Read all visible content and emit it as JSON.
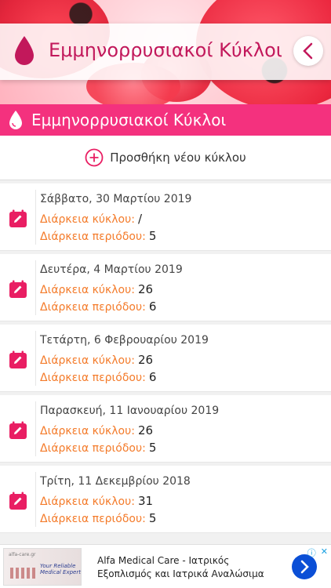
{
  "header": {
    "title": "Εμμηνορρυσιακοί Κύκλοι",
    "back_icon": "chevron-left-icon",
    "logo_icon": "blood-drop-icon"
  },
  "section": {
    "title": "Εμμηνορρυσιακοί Κύκλοι",
    "icon": "drop-icon"
  },
  "add_cycle": {
    "label": "Προσθήκη νέου κύκλου",
    "icon": "add-circle-icon"
  },
  "cycles": [
    {
      "date": "Σάββατο, 30 Μαρτίου 2019",
      "cycle_label": "Διάρκεια κύκλου:",
      "cycle_value": "/",
      "period_label": "Διάρκεια περιόδου:",
      "period_value": "5"
    },
    {
      "date": "Δευτέρα, 4 Μαρτίου 2019",
      "cycle_label": "Διάρκεια κύκλου:",
      "cycle_value": "26",
      "period_label": "Διάρκεια περιόδου:",
      "period_value": "6"
    },
    {
      "date": "Τετάρτη, 6 Φεβρουαρίου 2019",
      "cycle_label": "Διάρκεια κύκλου:",
      "cycle_value": "26",
      "period_label": "Διάρκεια περιόδου:",
      "period_value": "6"
    },
    {
      "date": "Παρασκευή, 11 Ιανουαρίου 2019",
      "cycle_label": "Διάρκεια κύκλου:",
      "cycle_value": "26",
      "period_label": "Διάρκεια περιόδου:",
      "period_value": "5"
    },
    {
      "date": "Τρίτη, 11 Δεκεμβρίου 2018",
      "cycle_label": "Διάρκεια κύκλου:",
      "cycle_value": "31",
      "period_label": "Διάρκεια περιόδου:",
      "period_value": "5"
    }
  ],
  "ad": {
    "thumb_mini": "alfa-care.gr",
    "thumb_headline": "Your Reliable Medical Expert",
    "line1": "Alfa Medical Care - Ιατρικός",
    "line2": "Εξοπλισμός και Ιατρικά Αναλώσιμα",
    "badge_info": "ⓘ",
    "badge_close": "✕"
  },
  "colors": {
    "accent": "#f4317e",
    "title": "#c2185b",
    "label_orange": "#f47b2a",
    "ad_button": "#0b4fd6"
  }
}
